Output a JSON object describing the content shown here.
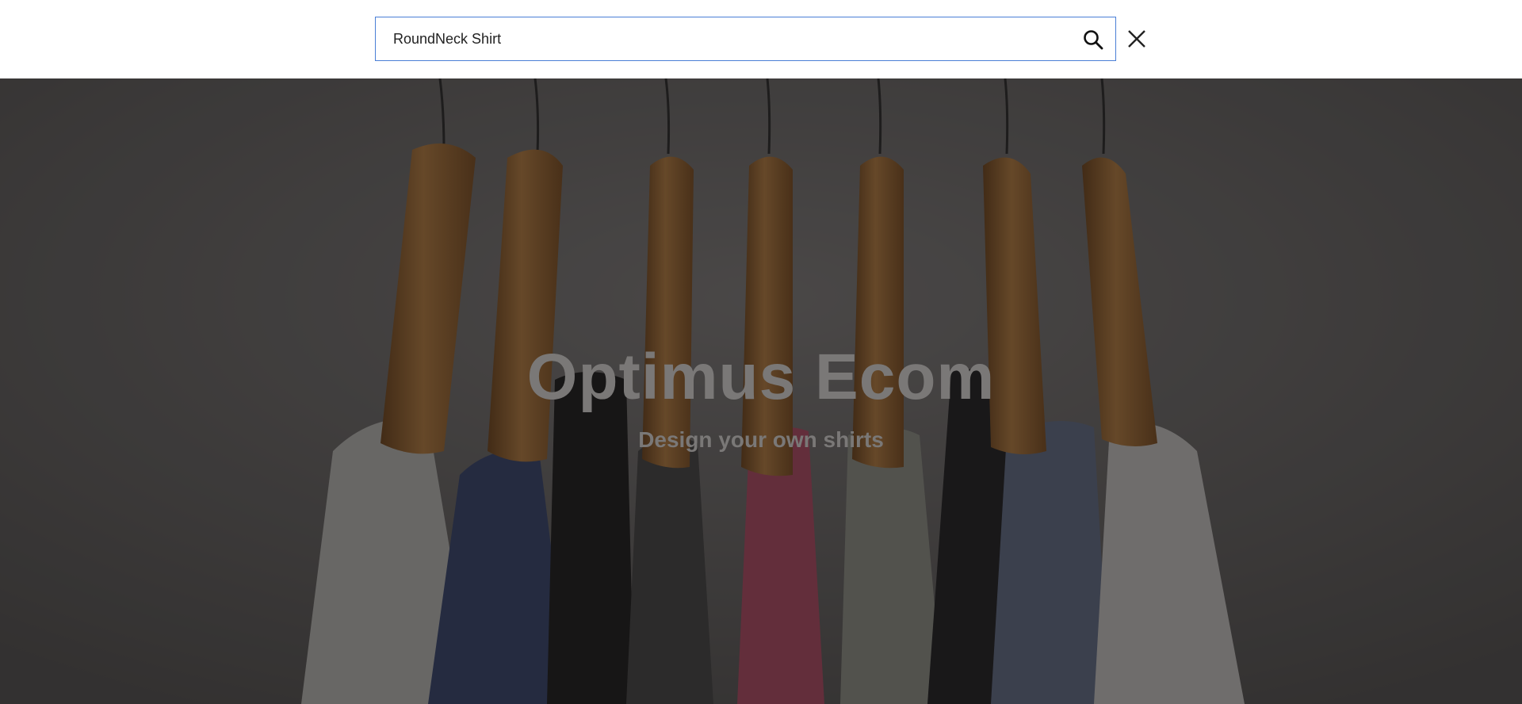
{
  "search": {
    "value": "RoundNeck Shirt",
    "placeholder": "",
    "submit_icon": "search-icon",
    "close_icon": "close-icon"
  },
  "hero": {
    "title": "Optimus Ecom",
    "subtitle": "Design your own shirts",
    "image_subject": "shirts-on-wooden-hangers"
  },
  "colors": {
    "search_border": "#4a7fd6",
    "hero_text": "#7a7877",
    "hero_overlay": "#141212"
  }
}
